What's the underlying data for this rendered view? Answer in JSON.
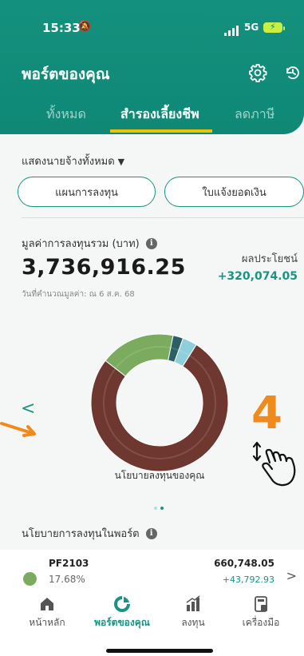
{
  "status_bar": {
    "time": "15:33",
    "network": "5G"
  },
  "header": {
    "title": "พอร์ตของคุณ"
  },
  "tabs": [
    {
      "label": "ทั้งหมด"
    },
    {
      "label": "สำรองเลี้ยงชีพ",
      "active": true
    },
    {
      "label": "ลดภาษี"
    }
  ],
  "employer_selector": {
    "label": "แสดงนายจ้างทั้งหมด"
  },
  "buttons": {
    "investment_plan": "แผนการลงทุน",
    "statement": "ใบแจ้งยอดเงิน"
  },
  "portfolio": {
    "value_label": "มูลค่าการลงทุนรวม (บาท)",
    "value": "3,736,916.25",
    "profit_label": "ผลประโยชน์",
    "profit": "+320,074.05",
    "valuation_date": "วันที่คำนวณมูลค่า: ณ 6 ส.ค. 68"
  },
  "chart_data": {
    "type": "pie",
    "title": "นโยบายลงทุนของคุณ",
    "slices": [
      {
        "value": 76.5,
        "color": "#6e3730"
      },
      {
        "value": 17.68,
        "color": "#7aab5e"
      },
      {
        "value": 2.4,
        "color": "#2b5f63"
      },
      {
        "value": 3.42,
        "color": "#8ecfda"
      }
    ],
    "carousel_page": 2,
    "carousel_total": 2
  },
  "overlay": {
    "step_number": "4"
  },
  "policy": {
    "label": "นโยบายการลงทุนในพอร์ต"
  },
  "funds": [
    {
      "name": "PF2103",
      "percent": "17.68%",
      "value": "660,748.05",
      "gain": "+43,792.93",
      "color": "#7aab5e"
    }
  ],
  "bottom_nav": [
    {
      "label": "หน้าหลัก",
      "icon": "home-icon"
    },
    {
      "label": "พอร์ตของคุณ",
      "icon": "portfolio-pie-icon",
      "active": true
    },
    {
      "label": "ลงทุน",
      "icon": "invest-chart-icon"
    },
    {
      "label": "เครื่องมือ",
      "icon": "tools-calculator-icon"
    }
  ],
  "colors": {
    "brand": "#0f8876",
    "accent": "#f2c200",
    "positive": "#1a9382",
    "annotation": "#f08a1c"
  }
}
